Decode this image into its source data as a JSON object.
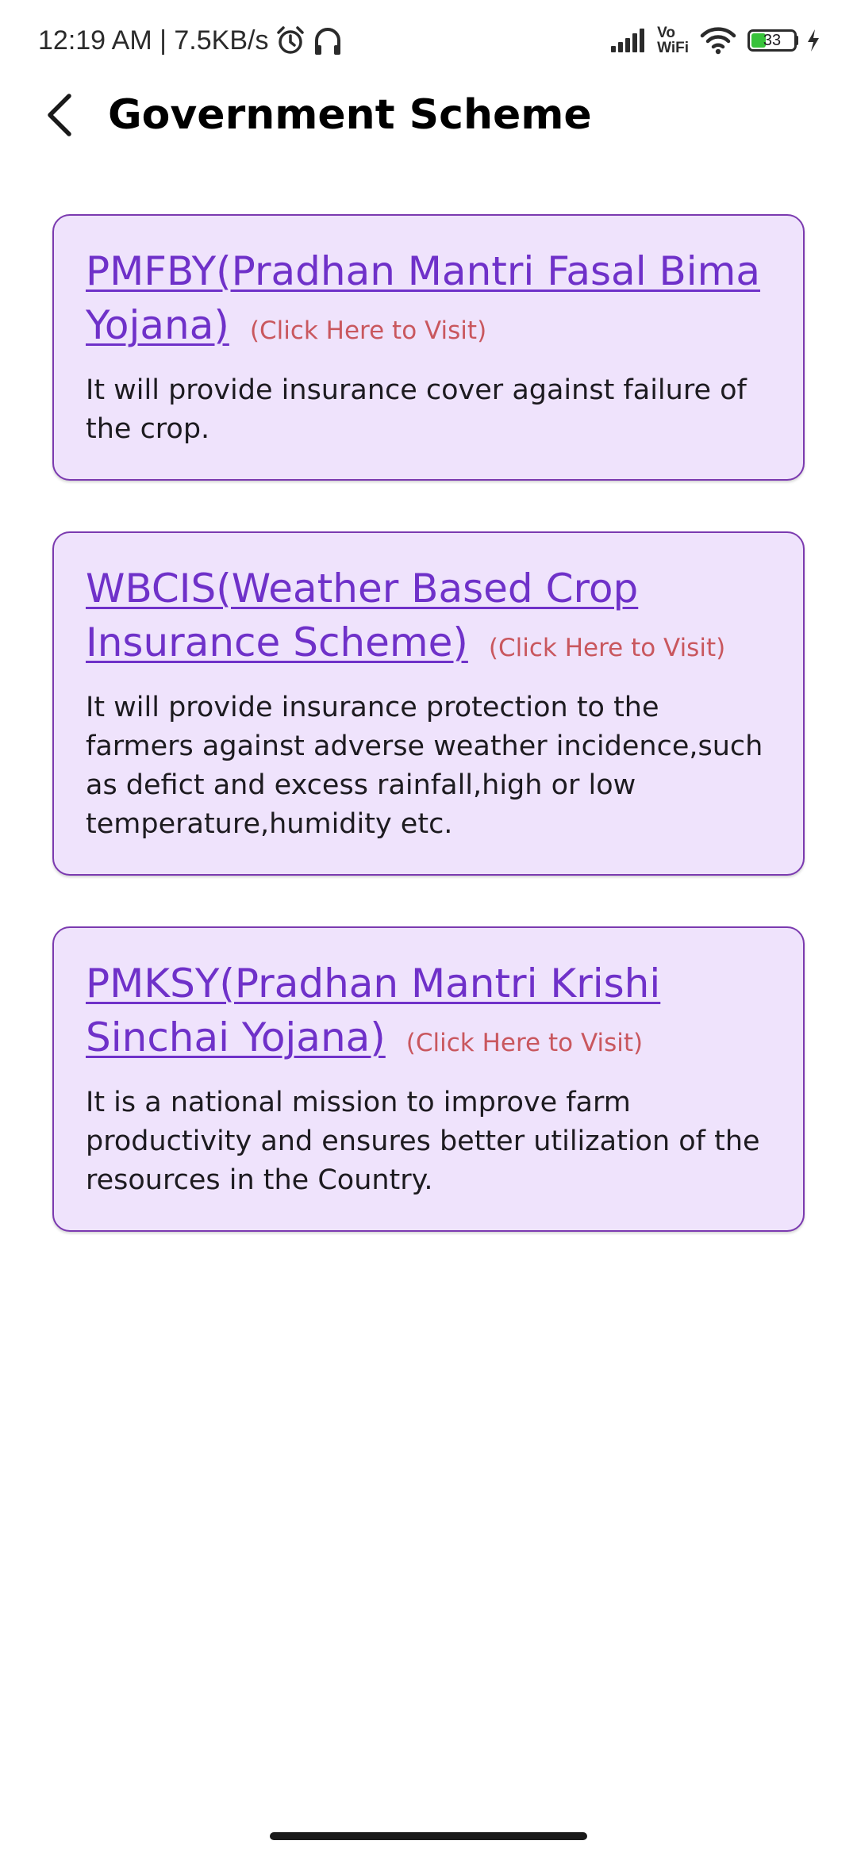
{
  "status_bar": {
    "time_text": "12:19 AM | 7.5KB/s",
    "vowifi_top": "Vo",
    "vowifi_bottom": "WiFi",
    "battery_level": "33",
    "icons": [
      "alarm-icon",
      "headphones-icon",
      "signal-icon",
      "wifi-icon",
      "battery-icon",
      "charging-icon"
    ]
  },
  "app_bar": {
    "title": "Government Scheme",
    "back_icon": "arrow-back-icon"
  },
  "schemes": [
    {
      "title": "PMFBY(Pradhan Mantri Fasal Bima Yojana)",
      "link_text": "(Click Here to Visit)",
      "description": "It will provide insurance cover against failure of the crop."
    },
    {
      "title": "WBCIS(Weather Based Crop Insurance Scheme)",
      "link_text": "(Click Here to Visit)",
      "description": "It will provide insurance protection to the farmers against adverse weather incidence,such as defict and excess rainfall,high or low temperature,humidity etc."
    },
    {
      "title": "PMKSY(Pradhan Mantri Krishi Sinchai Yojana)",
      "link_text": "(Click Here to Visit)",
      "description": "It is a national mission to improve farm productivity and ensures better utilization of the resources in the Country."
    }
  ],
  "colors": {
    "card_background": "#efe3fc",
    "card_border": "#7b3ab0",
    "title_link": "#6f31c9",
    "visit_link": "#c9575e",
    "battery_fill": "#37c23a"
  }
}
